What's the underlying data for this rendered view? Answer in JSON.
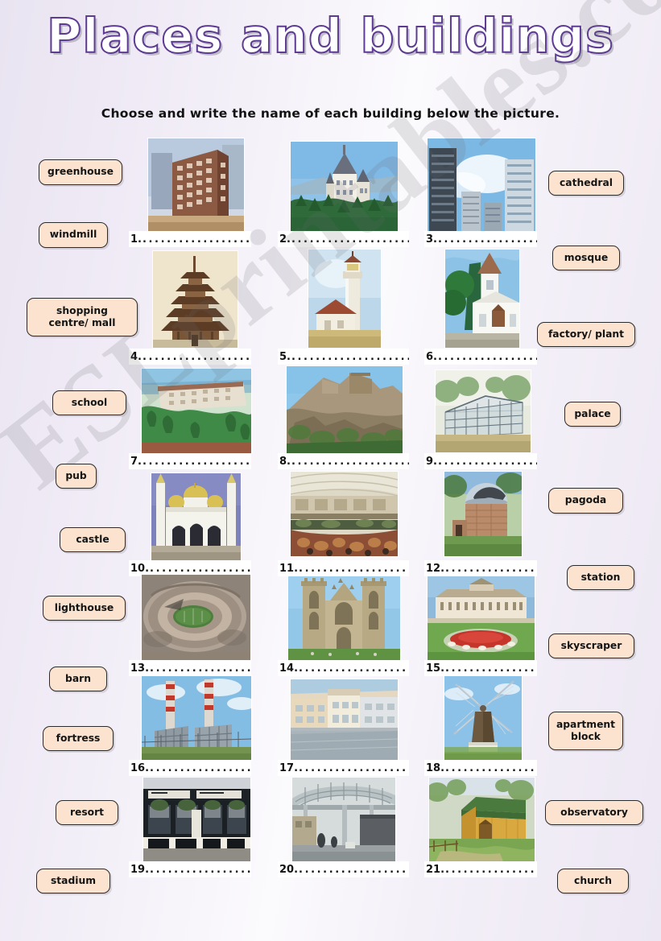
{
  "header": {
    "title": "Places and buildings",
    "instruction": "Choose and write the name of each building below the picture.",
    "title_stroke_color": "#5d3b93"
  },
  "watermark": {
    "text": "ESLprintables.com"
  },
  "chip_style": {
    "fill": "#fbe3cf",
    "border": "#2b2b2b"
  },
  "word_bank": {
    "left": [
      {
        "label": "greenhouse"
      },
      {
        "label": "windmill"
      },
      {
        "label": "shopping centre/ mall"
      },
      {
        "label": "school"
      },
      {
        "label": "pub"
      },
      {
        "label": "castle"
      },
      {
        "label": "lighthouse"
      },
      {
        "label": "barn"
      },
      {
        "label": "fortress"
      },
      {
        "label": "resort"
      },
      {
        "label": "stadium"
      }
    ],
    "right": [
      {
        "label": "cathedral"
      },
      {
        "label": "mosque"
      },
      {
        "label": "factory/ plant"
      },
      {
        "label": "palace"
      },
      {
        "label": "pagoda"
      },
      {
        "label": "station"
      },
      {
        "label": "skyscraper"
      },
      {
        "label": "apartment block"
      },
      {
        "label": "observatory"
      },
      {
        "label": "church"
      }
    ]
  },
  "items": [
    {
      "number": "1.",
      "dots": "....................",
      "picture": "apartment-block"
    },
    {
      "number": "2.",
      "dots": "......................",
      "picture": "castle"
    },
    {
      "number": "3.",
      "dots": "..................",
      "picture": "skyscraper"
    },
    {
      "number": "4.",
      "dots": "....................",
      "picture": "pagoda"
    },
    {
      "number": "5.",
      "dots": "......................",
      "picture": "lighthouse"
    },
    {
      "number": "6.",
      "dots": "..................",
      "picture": "church"
    },
    {
      "number": "7.",
      "dots": "....................",
      "picture": "resort"
    },
    {
      "number": "8.",
      "dots": "......................",
      "picture": "fortress"
    },
    {
      "number": "9.",
      "dots": "..................",
      "picture": "greenhouse"
    },
    {
      "number": "10.",
      "dots": "..................",
      "picture": "mosque"
    },
    {
      "number": "11.",
      "dots": "....................",
      "picture": "shopping-mall"
    },
    {
      "number": "12.",
      "dots": "................",
      "picture": "observatory"
    },
    {
      "number": "13.",
      "dots": "..................",
      "picture": "stadium"
    },
    {
      "number": "14.",
      "dots": "....................",
      "picture": "cathedral"
    },
    {
      "number": "15.",
      "dots": "................",
      "picture": "palace"
    },
    {
      "number": "16.",
      "dots": "..................",
      "picture": "factory-plant"
    },
    {
      "number": "17.",
      "dots": "....................",
      "picture": "school"
    },
    {
      "number": "18.",
      "dots": "................",
      "picture": "windmill"
    },
    {
      "number": "19.",
      "dots": "..................",
      "picture": "pub"
    },
    {
      "number": "20.",
      "dots": "....................",
      "picture": "station"
    },
    {
      "number": "21.",
      "dots": "................",
      "picture": "barn"
    }
  ]
}
